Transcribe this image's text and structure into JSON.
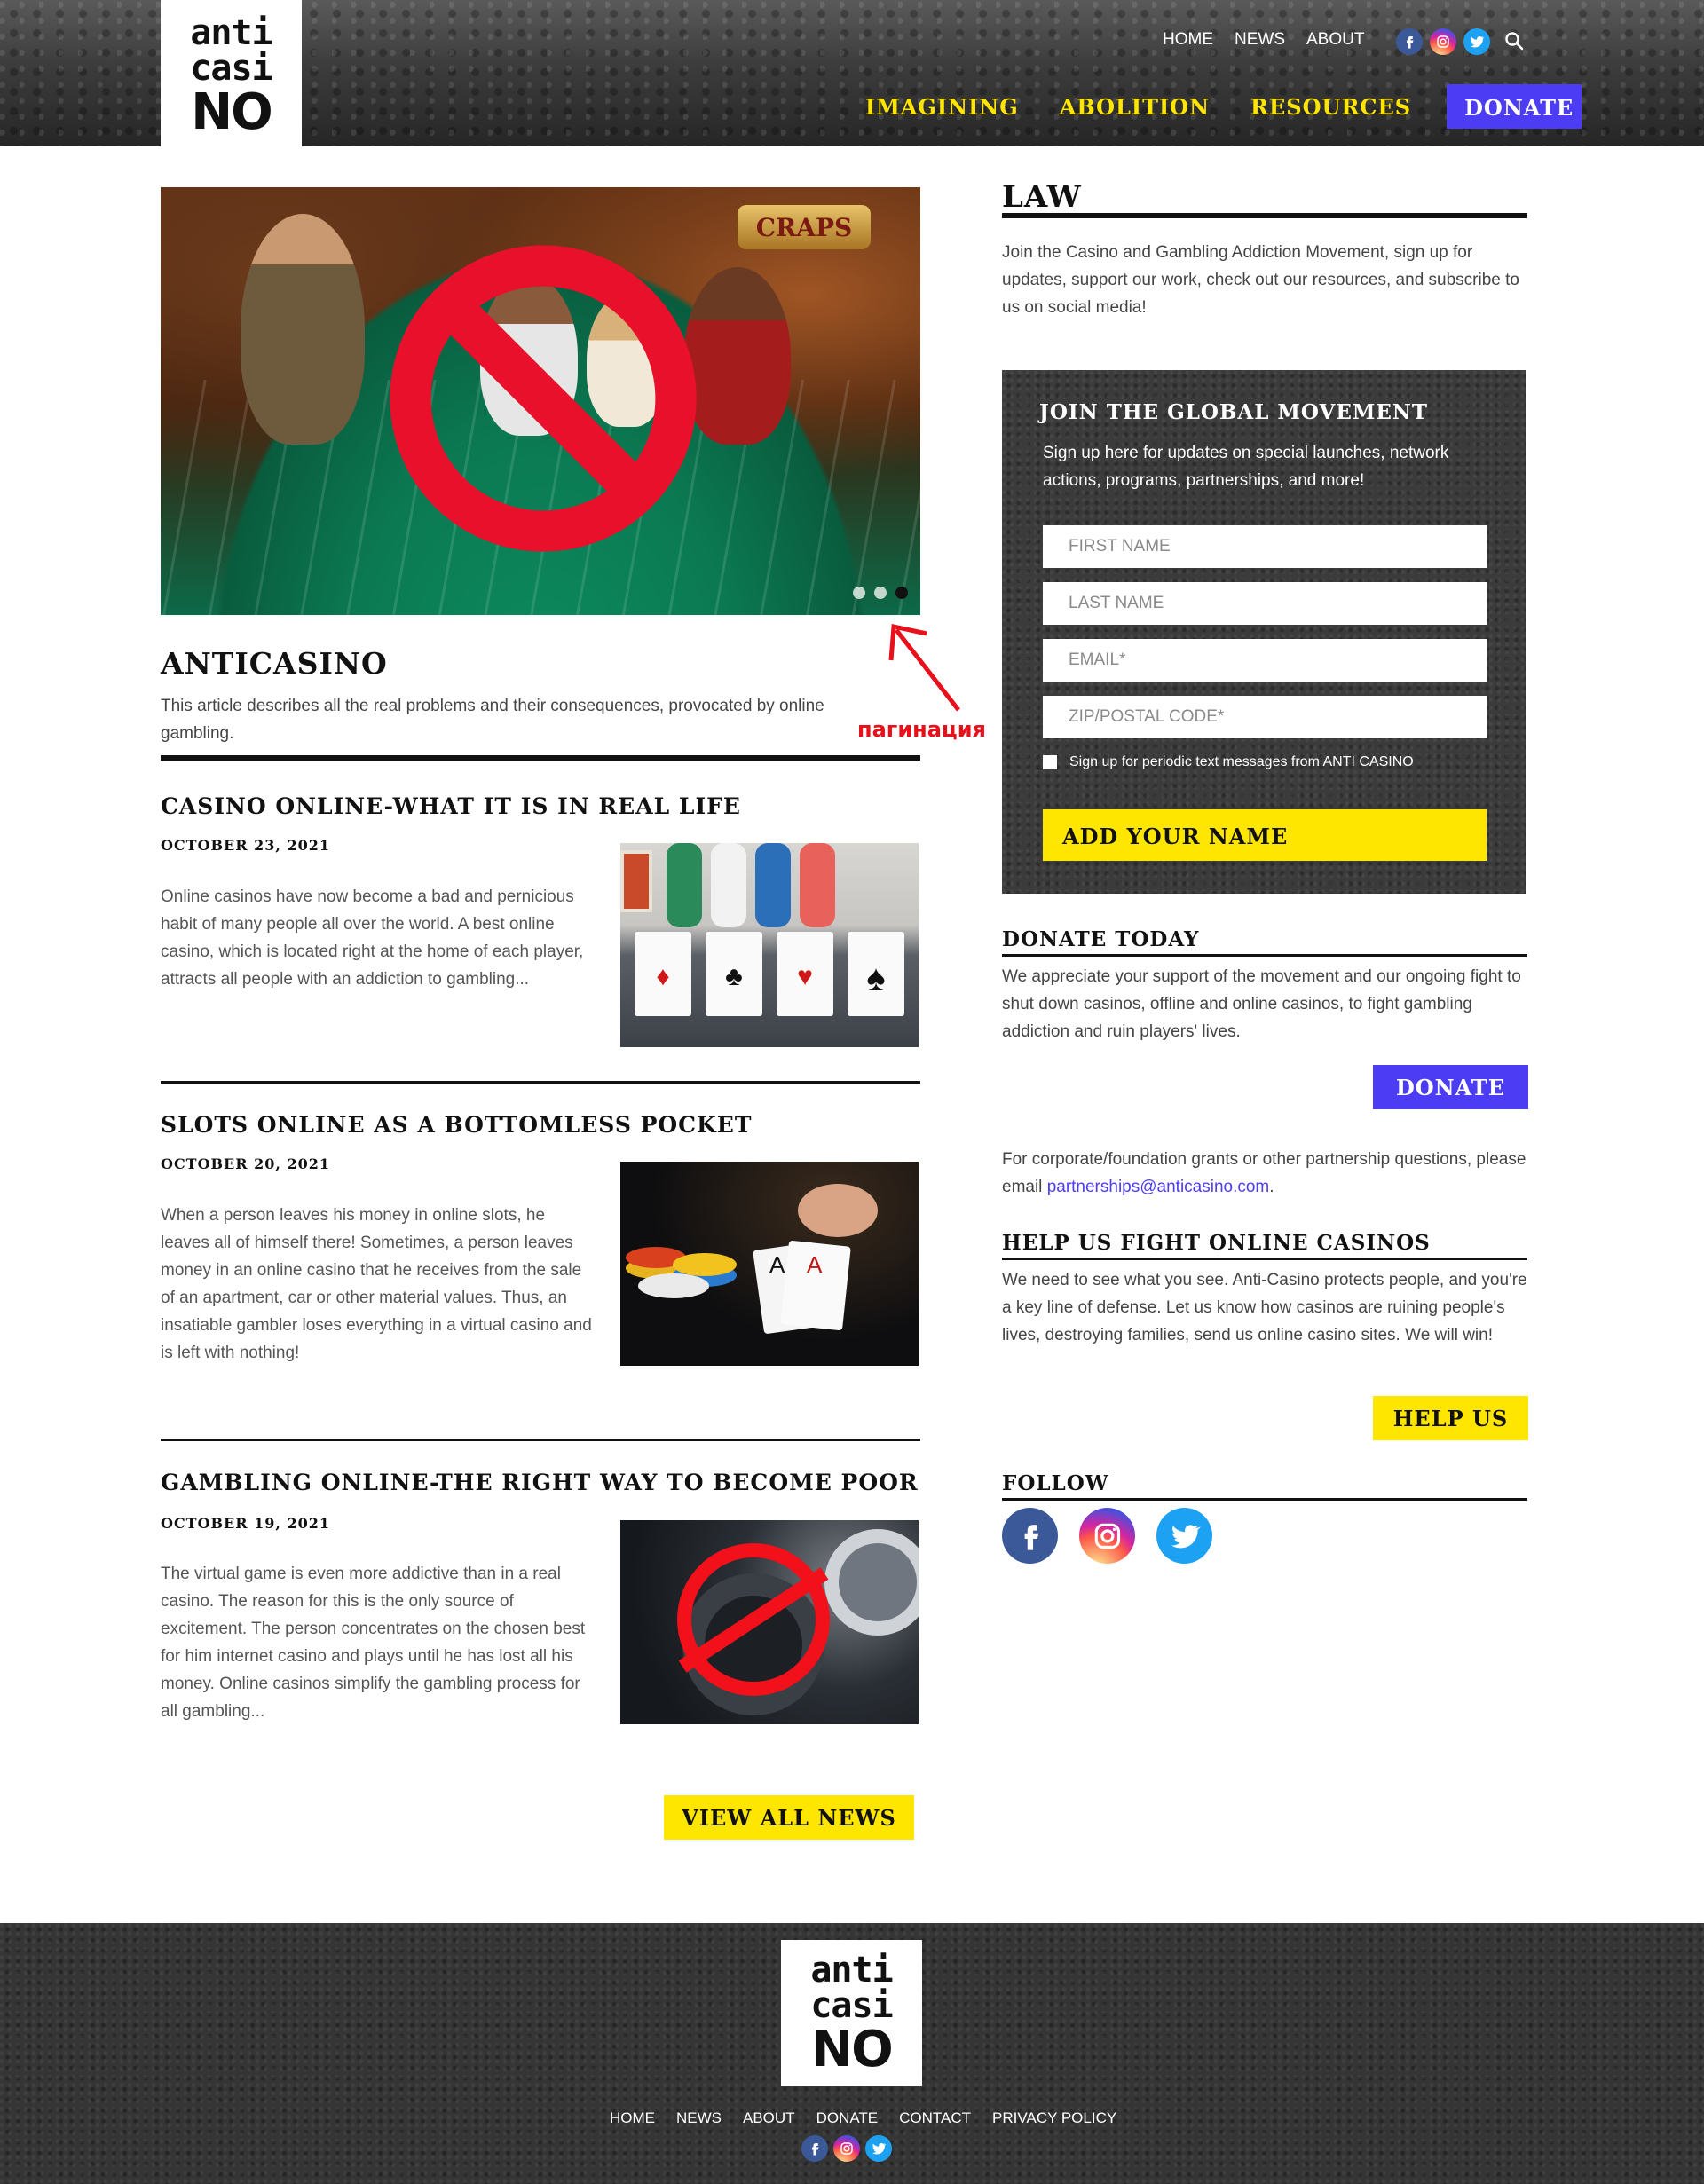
{
  "header": {
    "logo": {
      "line1": "anti",
      "line2": "casi",
      "line3": "NO"
    },
    "topnav": [
      "HOME",
      "NEWS",
      "ABOUT"
    ],
    "social_icons": [
      "facebook-icon",
      "instagram-icon",
      "twitter-icon"
    ],
    "search_icon": "search-icon",
    "mainnav": [
      "IMAGINING",
      "ABOLITION",
      "RESOURCES"
    ],
    "donate_label": "DONATE"
  },
  "slider": {
    "sign_text": "CRAPS",
    "slide_count": 3,
    "active_slide": 3
  },
  "annotation": {
    "label": "пагинация"
  },
  "intro": {
    "title": "ANTICASINO",
    "text": "This article describes all the real problems and their consequences, provocated by online gambling."
  },
  "posts": [
    {
      "title": "CASINO ONLINE-WHAT IT IS IN REAL LIFE",
      "date": "OCTOBER 23, 2021",
      "text": "Online casinos have now become a bad and pernicious habit of many people all over the world. A best online casino, which is located right at the home of each player, attracts all people with an addiction to gambling..."
    },
    {
      "title": "SLOTS ONLINE AS A BOTTOMLESS POCKET",
      "date": "OCTOBER 20, 2021",
      "text": "When a person leaves his money in online slots, he leaves all of himself there! Sometimes, a person leaves money in an online casino that he receives from the sale of an apartment, car or other material values. Thus, an insatiable gambler loses everything in a virtual casino and is left with nothing!"
    },
    {
      "title": "GAMBLING ONLINE-THE RIGHT WAY TO BECOME POOR",
      "date": "OCTOBER 19, 2021",
      "text": "The virtual game is even more addictive than in a real casino. The reason for this is the only source of excitement. The person concentrates on the chosen best for him internet casino and plays until he has lost all his money. Online casinos simplify the gambling process for all gambling..."
    }
  ],
  "view_all_label": "VIEW ALL NEWS",
  "law": {
    "title": "LAW",
    "text": "Join the Casino and Gambling Addiction Movement, sign up for updates, support our work, check out our resources, and subscribe to us on social media!"
  },
  "join": {
    "title": "JOIN THE GLOBAL MOVEMENT",
    "text": "Sign up here for updates on special launches, network actions, programs, partnerships, and more!",
    "fields": {
      "first_name": "FIRST NAME",
      "last_name": "LAST NAME",
      "email": "EMAIL*",
      "zip": "ZIP/POSTAL CODE*"
    },
    "checkbox_label": "Sign up for periodic text messages from ANTI CASINO",
    "button_label": "ADD YOUR NAME"
  },
  "donate_section": {
    "title": "DONATE TODAY",
    "text": "We appreciate your support of the movement and our ongoing fight to shut down casinos, offline and online casinos, to fight gambling addiction and ruin players' lives.",
    "button_label": "DONATE",
    "partner_text": "For corporate/foundation grants or other partnership questions, please email ",
    "partner_email": "partnerships@anticasino.com",
    "partner_end": "."
  },
  "help_section": {
    "title": "HELP US FIGHT ONLINE CASINOS",
    "text": "We need to see what you see. Anti-Casino protects people, and you're a key line of defense. Let us know how casinos are ruining people's lives, destroying families, send us online casino sites. We will win!",
    "button_label": "HELP US"
  },
  "follow": {
    "title": "FOLLOW",
    "icons": [
      "facebook-icon",
      "instagram-icon",
      "twitter-icon"
    ]
  },
  "footer": {
    "logo": {
      "line1": "anti",
      "line2": "casi",
      "line3": "NO"
    },
    "nav": [
      "HOME",
      "NEWS",
      "ABOUT",
      "DONATE",
      "CONTACT",
      "PRIVACY POLICY"
    ],
    "social_icons": [
      "facebook-icon",
      "instagram-icon",
      "twitter-icon"
    ]
  },
  "colors": {
    "accent_yellow": "#ffe600",
    "accent_blue": "#4c3df5",
    "text_dark": "#111111",
    "annotation_red": "#e8101b"
  }
}
